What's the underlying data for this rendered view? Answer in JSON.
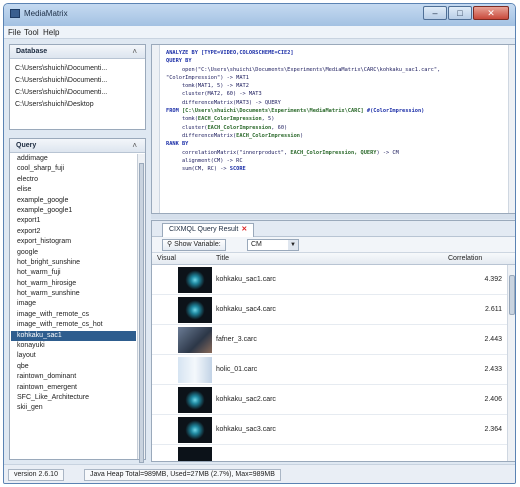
{
  "window": {
    "title": "MediaMatrix",
    "buttons": [
      "–",
      "□",
      "✕"
    ]
  },
  "menu": [
    "File",
    "Tool",
    "Help"
  ],
  "database": {
    "title": "Database",
    "collapse_icon": "chevron-up-icon",
    "items": [
      "C:\\Users\\shuichi\\Documenti...",
      "C:\\Users\\shuichi\\Documenti...",
      "C:\\Users\\shuichi\\Documenti...",
      "C:\\Users\\shuichi\\Desktop"
    ]
  },
  "query": {
    "title": "Query",
    "items": [
      "addimage",
      "cool_sharp_fuji",
      "electro",
      "elise",
      "example_google",
      "example_google1",
      "export1",
      "export2",
      "export_histogram",
      "google",
      "hot_bright_sunshine",
      "hot_warm_fuji",
      "hot_warm_hirosige",
      "hot_warm_sunshine",
      "image",
      "image_with_remote_cs",
      "image_with_remote_cs_hot",
      "kohkaku_sac1",
      "konayuki",
      "layout",
      "qbe",
      "raintown_dominant",
      "raintown_emergent",
      "SFC_Like_Architecture",
      "skii_gen"
    ],
    "selected_index": 17
  },
  "code_lines": [
    [
      {
        "t": "ANALYZE BY ",
        "c": "kw"
      },
      {
        "t": "[TYPE=VIDEO,COLORSCHEME=CIE2]",
        "c": "kw"
      }
    ],
    [
      {
        "t": "QUERY BY",
        "c": "kw"
      }
    ],
    [
      {
        "t": "     open(\"C:\\Users\\shuichi\\Documents\\Experiments\\MediaMatrix\\CARC\\kohkaku_sac1.carc\",",
        "c": "str"
      }
    ],
    [
      {
        "t": "\"ColorImpression\") -> MAT1",
        "c": "str"
      }
    ],
    [
      {
        "t": "     tomk(MAT1, 5) -> MAT2",
        "c": "str"
      }
    ],
    [
      {
        "t": "     cluster(MAT2, 60) -> MAT3",
        "c": "str"
      }
    ],
    [
      {
        "t": "     differenceMatrix(MAT3) -> QUERY",
        "c": "str"
      }
    ],
    [
      {
        "t": "FROM ",
        "c": "kw"
      },
      {
        "t": "[C:\\Users\\shuichi\\Documents\\Experiments\\MediaMatrix\\CARC]",
        "c": "hl"
      },
      {
        "t": " #(ColorImpression)",
        "c": "kw"
      }
    ],
    [
      {
        "t": "     tomk(",
        "c": "str"
      },
      {
        "t": "EACH_ColorImpression",
        "c": "hl"
      },
      {
        "t": ", 5)",
        "c": "str"
      }
    ],
    [
      {
        "t": "     cluster(",
        "c": "str"
      },
      {
        "t": "EACH_ColorImpression",
        "c": "hl"
      },
      {
        "t": ", 60)",
        "c": "str"
      }
    ],
    [
      {
        "t": "     differenceMatrix(",
        "c": "str"
      },
      {
        "t": "EACH_ColorImpression",
        "c": "hl"
      },
      {
        "t": ")",
        "c": "str"
      }
    ],
    [
      {
        "t": "RANK BY",
        "c": "kw"
      }
    ],
    [
      {
        "t": "     correlationMatrix(\"innerproduct\", ",
        "c": "str"
      },
      {
        "t": "EACH_ColorImpression, QUERY",
        "c": "hl"
      },
      {
        "t": ") -> CM",
        "c": "str"
      }
    ],
    [
      {
        "t": "     alignment(CM) -> RC",
        "c": "str"
      }
    ],
    [
      {
        "t": "     sum(CM, RC) -> ",
        "c": "str"
      },
      {
        "t": "SCORE",
        "c": "kw"
      }
    ]
  ],
  "result": {
    "tab_label": "CIXMQL Query Result",
    "show_variable_label": "Show Variable:",
    "variable_value": "CM",
    "columns": [
      "Visual",
      "Title",
      "Correlation"
    ],
    "rows": [
      {
        "title": "kohkaku_sac1.carc",
        "corr": "4.392",
        "thumb": "blue"
      },
      {
        "title": "kohkaku_sac4.carc",
        "corr": "2.611",
        "thumb": "blue"
      },
      {
        "title": "fafner_3.carc",
        "corr": "2.443",
        "thumb": "photo"
      },
      {
        "title": "holic_01.carc",
        "corr": "2.433",
        "thumb": "white"
      },
      {
        "title": "kohkaku_sac2.carc",
        "corr": "2.406",
        "thumb": "blue"
      },
      {
        "title": "kohkaku_sac3.carc",
        "corr": "2.364",
        "thumb": "blue"
      },
      {
        "title": "",
        "corr": "",
        "thumb": "dark"
      }
    ]
  },
  "status": {
    "version": "version 2.6.10",
    "heap": "Java Heap Total=989MB, Used=27MB (2.7%), Max=989MB"
  }
}
